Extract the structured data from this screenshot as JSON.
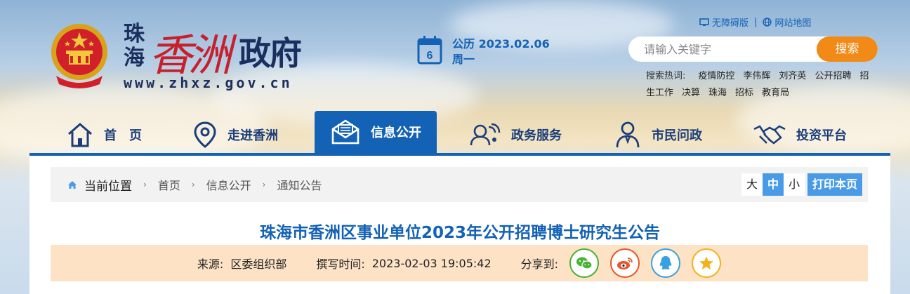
{
  "header": {
    "site_name_small": "珠海",
    "site_name_script": "香洲",
    "site_name_main": "政府",
    "site_url": "www.zhxz.gov.cn",
    "date_label": "公历 2023.02.06",
    "weekday": "周一",
    "calendar_day": "6",
    "accessible_label": "无障碍版",
    "sitemap_label": "网站地图",
    "search": {
      "placeholder": "请输入关键字",
      "button_label": "搜索"
    },
    "hot_label": "搜索热词:",
    "hot_keywords": [
      "疫情防控",
      "李伟辉",
      "刘齐英",
      "公开招聘",
      "招生工作",
      "决算",
      "珠海",
      "招标",
      "教育局"
    ]
  },
  "nav": {
    "items": [
      {
        "label": "首　页",
        "icon": "home-icon"
      },
      {
        "label": "走进香洲",
        "icon": "location-pin-icon"
      },
      {
        "label": "信息公开",
        "icon": "mail-icon"
      },
      {
        "label": "政务服务",
        "icon": "people-service-icon"
      },
      {
        "label": "市民问政",
        "icon": "citizen-icon"
      },
      {
        "label": "投资平台",
        "icon": "handshake-icon"
      }
    ],
    "active_index": 2
  },
  "breadcrumb": {
    "current_label": "当前位置",
    "items": [
      "首页",
      "信息公开",
      "通知公告"
    ]
  },
  "font_size": {
    "large": "大",
    "medium": "中",
    "small": "小",
    "print": "打印本页"
  },
  "article": {
    "title": "珠海市香洲区事业单位2023年公开招聘博士研究生公告",
    "source_label": "来源:",
    "source_value": "区委组织部",
    "time_label": "撰写时间:",
    "time_value": "2023-02-03 19:05:42",
    "share_label": "分享到:"
  },
  "colors": {
    "primary_blue": "#1462b5",
    "search_orange": "#f18a16",
    "brand_red": "#c8202b",
    "meta_bg": "#fde2c6"
  }
}
